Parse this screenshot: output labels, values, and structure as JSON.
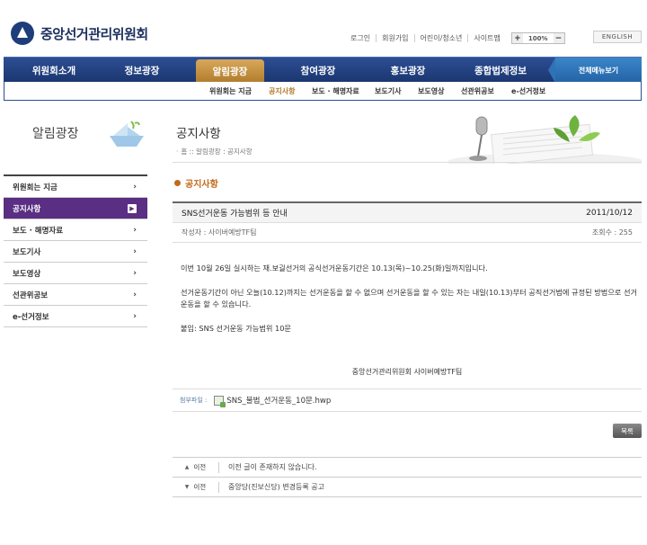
{
  "header": {
    "logo_text": "중앙선거관리위원회",
    "utility": [
      "로그인",
      "회원가입",
      "어린이/청소년",
      "사이트맵"
    ],
    "zoom_plus": "+",
    "zoom_value": "100%",
    "zoom_minus": "−",
    "english": "ENGLISH"
  },
  "gnb": {
    "items": [
      "위원회소개",
      "정보광장",
      "알림광장",
      "참여광장",
      "홍보광장",
      "종합법제정보"
    ],
    "active_index": 2,
    "all_menu": "전체메뉴보기"
  },
  "subnav": {
    "items": [
      "위원회는 지금",
      "공지사항",
      "보도 · 해명자료",
      "보도기사",
      "보도영상",
      "선관위공보",
      "e-선거정보"
    ],
    "active_index": 1
  },
  "lnb": {
    "title": "알림광장",
    "items": [
      "위원회는 지금",
      "공지사항",
      "보도 · 해명자료",
      "보도기사",
      "보도영상",
      "선관위공보",
      "e-선거정보"
    ],
    "active_index": 1,
    "arrow": "›"
  },
  "content": {
    "page_title": "공지사항",
    "breadcrumb": "홈 :: 알림광장 : 공지사항",
    "section_title": "공지사항",
    "post": {
      "title": "SNS선거운동 가능범위 등 안내",
      "date": "2011/10/12",
      "author": "작성자 : 사이버예방TF팀",
      "views": "조회수 : 255",
      "paragraphs": [
        "이번 10월 26일 실시하는 재.보궐선거의 공식선거운동기간은 10.13(목)~10.25(화)일까지입니다.",
        "선거운동기간이 아닌 오늘(10.12)까지는 선거운동을 할 수 없으며 선거운동을 할 수 있는 자는 내일(10.13)부터 공직선거법에 규정된 방법으로 선거운동을 할 수 있습니다.",
        "붙임: SNS 선거운동 가능범위 10문"
      ],
      "signature": "중앙선거관리위원회 사이버예방TF팀",
      "attach_label": "첨부파일 :",
      "attach_file": "SNS_불법_선거운동_10문.hwp"
    },
    "list_button": "목록",
    "prev_next": [
      {
        "label": "이전",
        "text": "이전 글이 존재하지 않습니다."
      },
      {
        "label": "이전",
        "text": "중앙당(진보신당) 변경등록 공고"
      }
    ]
  }
}
